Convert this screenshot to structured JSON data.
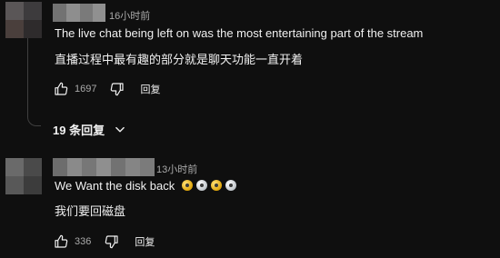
{
  "comments": [
    {
      "timestamp": "16小时前",
      "text_en": "The live chat being left on was the most entertaining part of the stream",
      "text_zh": "直播过程中最有趣的部分就是聊天功能一直开着",
      "likes": "1697",
      "reply_label": "回复",
      "replies_toggle": "19 条回复"
    },
    {
      "timestamp": "13小时前",
      "text_en": "We Want the disk back",
      "text_zh": "我们要回磁盘",
      "likes": "336",
      "reply_label": "回复"
    }
  ],
  "icons": {
    "like": "thumbs-up-icon",
    "dislike": "thumbs-down-icon",
    "expand": "chevron-down-icon",
    "emoji": "disc-emoji-icon"
  },
  "colors": {
    "background": "#0f0f0f",
    "text": "#f1f1f1",
    "muted_text": "#aaaaaa",
    "emoji_gold": "#e0a50a",
    "emoji_silver": "#d8dce0"
  }
}
